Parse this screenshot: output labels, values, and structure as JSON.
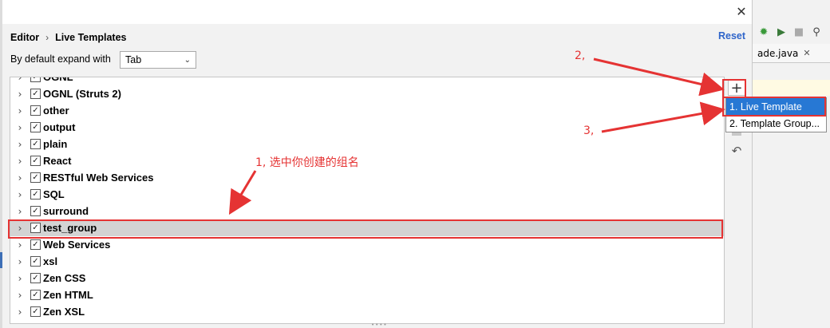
{
  "breadcrumb": {
    "root": "Editor",
    "current": "Live Templates"
  },
  "reset_label": "Reset",
  "expand": {
    "label": "By default expand with",
    "value": "Tab"
  },
  "tree_rows": [
    {
      "label": "OGNL",
      "checked": true
    },
    {
      "label": "OGNL (Struts 2)",
      "checked": true
    },
    {
      "label": "other",
      "checked": true
    },
    {
      "label": "output",
      "checked": true
    },
    {
      "label": "plain",
      "checked": true
    },
    {
      "label": "React",
      "checked": true
    },
    {
      "label": "RESTful Web Services",
      "checked": true
    },
    {
      "label": "SQL",
      "checked": true
    },
    {
      "label": "surround",
      "checked": true
    },
    {
      "label": "test_group",
      "checked": true,
      "selected": true
    },
    {
      "label": "Web Services",
      "checked": true
    },
    {
      "label": "xsl",
      "checked": true
    },
    {
      "label": "Zen CSS",
      "checked": true
    },
    {
      "label": "Zen HTML",
      "checked": true
    },
    {
      "label": "Zen XSL",
      "checked": true
    }
  ],
  "popup": {
    "items": [
      "1. Live Template",
      "2. Template Group..."
    ]
  },
  "annotations": {
    "one": "1, 选中你创建的组名",
    "two": "2,",
    "three": "3,"
  },
  "ide": {
    "tab_label": "ade.java"
  },
  "colors": {
    "annotation_red": "#e53333",
    "popup_highlight": "#2778d4",
    "link_blue": "#2f65ca"
  }
}
